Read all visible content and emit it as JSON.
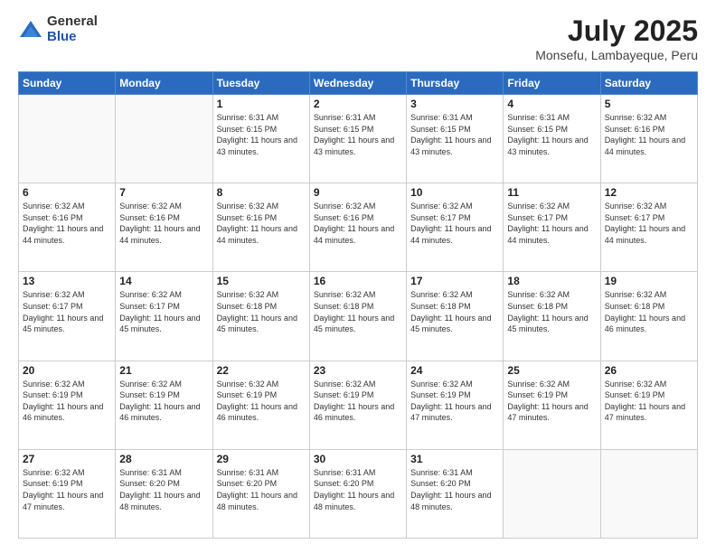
{
  "logo": {
    "general": "General",
    "blue": "Blue"
  },
  "title": {
    "month": "July 2025",
    "location": "Monsefu, Lambayeque, Peru"
  },
  "weekdays": [
    "Sunday",
    "Monday",
    "Tuesday",
    "Wednesday",
    "Thursday",
    "Friday",
    "Saturday"
  ],
  "weeks": [
    [
      {
        "num": "",
        "sunrise": "",
        "sunset": "",
        "daylight": ""
      },
      {
        "num": "",
        "sunrise": "",
        "sunset": "",
        "daylight": ""
      },
      {
        "num": "1",
        "sunrise": "Sunrise: 6:31 AM",
        "sunset": "Sunset: 6:15 PM",
        "daylight": "Daylight: 11 hours and 43 minutes."
      },
      {
        "num": "2",
        "sunrise": "Sunrise: 6:31 AM",
        "sunset": "Sunset: 6:15 PM",
        "daylight": "Daylight: 11 hours and 43 minutes."
      },
      {
        "num": "3",
        "sunrise": "Sunrise: 6:31 AM",
        "sunset": "Sunset: 6:15 PM",
        "daylight": "Daylight: 11 hours and 43 minutes."
      },
      {
        "num": "4",
        "sunrise": "Sunrise: 6:31 AM",
        "sunset": "Sunset: 6:15 PM",
        "daylight": "Daylight: 11 hours and 43 minutes."
      },
      {
        "num": "5",
        "sunrise": "Sunrise: 6:32 AM",
        "sunset": "Sunset: 6:16 PM",
        "daylight": "Daylight: 11 hours and 44 minutes."
      }
    ],
    [
      {
        "num": "6",
        "sunrise": "Sunrise: 6:32 AM",
        "sunset": "Sunset: 6:16 PM",
        "daylight": "Daylight: 11 hours and 44 minutes."
      },
      {
        "num": "7",
        "sunrise": "Sunrise: 6:32 AM",
        "sunset": "Sunset: 6:16 PM",
        "daylight": "Daylight: 11 hours and 44 minutes."
      },
      {
        "num": "8",
        "sunrise": "Sunrise: 6:32 AM",
        "sunset": "Sunset: 6:16 PM",
        "daylight": "Daylight: 11 hours and 44 minutes."
      },
      {
        "num": "9",
        "sunrise": "Sunrise: 6:32 AM",
        "sunset": "Sunset: 6:16 PM",
        "daylight": "Daylight: 11 hours and 44 minutes."
      },
      {
        "num": "10",
        "sunrise": "Sunrise: 6:32 AM",
        "sunset": "Sunset: 6:17 PM",
        "daylight": "Daylight: 11 hours and 44 minutes."
      },
      {
        "num": "11",
        "sunrise": "Sunrise: 6:32 AM",
        "sunset": "Sunset: 6:17 PM",
        "daylight": "Daylight: 11 hours and 44 minutes."
      },
      {
        "num": "12",
        "sunrise": "Sunrise: 6:32 AM",
        "sunset": "Sunset: 6:17 PM",
        "daylight": "Daylight: 11 hours and 44 minutes."
      }
    ],
    [
      {
        "num": "13",
        "sunrise": "Sunrise: 6:32 AM",
        "sunset": "Sunset: 6:17 PM",
        "daylight": "Daylight: 11 hours and 45 minutes."
      },
      {
        "num": "14",
        "sunrise": "Sunrise: 6:32 AM",
        "sunset": "Sunset: 6:17 PM",
        "daylight": "Daylight: 11 hours and 45 minutes."
      },
      {
        "num": "15",
        "sunrise": "Sunrise: 6:32 AM",
        "sunset": "Sunset: 6:18 PM",
        "daylight": "Daylight: 11 hours and 45 minutes."
      },
      {
        "num": "16",
        "sunrise": "Sunrise: 6:32 AM",
        "sunset": "Sunset: 6:18 PM",
        "daylight": "Daylight: 11 hours and 45 minutes."
      },
      {
        "num": "17",
        "sunrise": "Sunrise: 6:32 AM",
        "sunset": "Sunset: 6:18 PM",
        "daylight": "Daylight: 11 hours and 45 minutes."
      },
      {
        "num": "18",
        "sunrise": "Sunrise: 6:32 AM",
        "sunset": "Sunset: 6:18 PM",
        "daylight": "Daylight: 11 hours and 45 minutes."
      },
      {
        "num": "19",
        "sunrise": "Sunrise: 6:32 AM",
        "sunset": "Sunset: 6:18 PM",
        "daylight": "Daylight: 11 hours and 46 minutes."
      }
    ],
    [
      {
        "num": "20",
        "sunrise": "Sunrise: 6:32 AM",
        "sunset": "Sunset: 6:19 PM",
        "daylight": "Daylight: 11 hours and 46 minutes."
      },
      {
        "num": "21",
        "sunrise": "Sunrise: 6:32 AM",
        "sunset": "Sunset: 6:19 PM",
        "daylight": "Daylight: 11 hours and 46 minutes."
      },
      {
        "num": "22",
        "sunrise": "Sunrise: 6:32 AM",
        "sunset": "Sunset: 6:19 PM",
        "daylight": "Daylight: 11 hours and 46 minutes."
      },
      {
        "num": "23",
        "sunrise": "Sunrise: 6:32 AM",
        "sunset": "Sunset: 6:19 PM",
        "daylight": "Daylight: 11 hours and 46 minutes."
      },
      {
        "num": "24",
        "sunrise": "Sunrise: 6:32 AM",
        "sunset": "Sunset: 6:19 PM",
        "daylight": "Daylight: 11 hours and 47 minutes."
      },
      {
        "num": "25",
        "sunrise": "Sunrise: 6:32 AM",
        "sunset": "Sunset: 6:19 PM",
        "daylight": "Daylight: 11 hours and 47 minutes."
      },
      {
        "num": "26",
        "sunrise": "Sunrise: 6:32 AM",
        "sunset": "Sunset: 6:19 PM",
        "daylight": "Daylight: 11 hours and 47 minutes."
      }
    ],
    [
      {
        "num": "27",
        "sunrise": "Sunrise: 6:32 AM",
        "sunset": "Sunset: 6:19 PM",
        "daylight": "Daylight: 11 hours and 47 minutes."
      },
      {
        "num": "28",
        "sunrise": "Sunrise: 6:31 AM",
        "sunset": "Sunset: 6:20 PM",
        "daylight": "Daylight: 11 hours and 48 minutes."
      },
      {
        "num": "29",
        "sunrise": "Sunrise: 6:31 AM",
        "sunset": "Sunset: 6:20 PM",
        "daylight": "Daylight: 11 hours and 48 minutes."
      },
      {
        "num": "30",
        "sunrise": "Sunrise: 6:31 AM",
        "sunset": "Sunset: 6:20 PM",
        "daylight": "Daylight: 11 hours and 48 minutes."
      },
      {
        "num": "31",
        "sunrise": "Sunrise: 6:31 AM",
        "sunset": "Sunset: 6:20 PM",
        "daylight": "Daylight: 11 hours and 48 minutes."
      },
      {
        "num": "",
        "sunrise": "",
        "sunset": "",
        "daylight": ""
      },
      {
        "num": "",
        "sunrise": "",
        "sunset": "",
        "daylight": ""
      }
    ]
  ]
}
